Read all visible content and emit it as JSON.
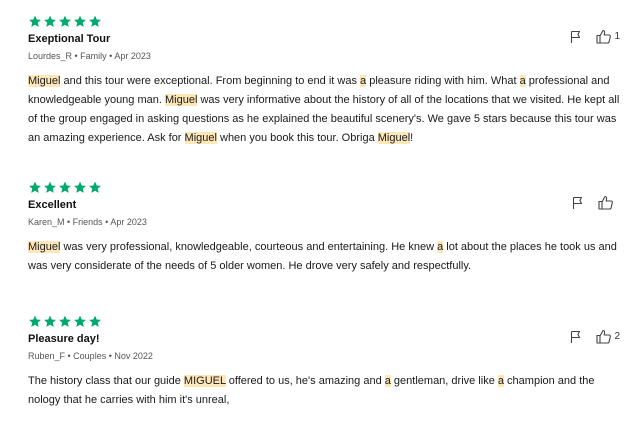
{
  "colors": {
    "star": "#00aa6c",
    "highlight": "#fde6b8"
  },
  "icons": {
    "rating": "star-icon",
    "report": "flag-icon",
    "helpful": "thumbs-up-icon"
  },
  "reviews": [
    {
      "rating": 5,
      "title": "Exeptional Tour",
      "meta": "Lourdes_R • Family • Apr 2023",
      "helpful_count": "1",
      "body": [
        {
          "t": "Miguel",
          "h": true
        },
        {
          "t": " and this tour were exceptional. From beginning to end it was "
        },
        {
          "t": "a",
          "h": true
        },
        {
          "t": " pleasure riding with him. What "
        },
        {
          "t": "a",
          "h": true
        },
        {
          "t": " professional and knowledgeable young man. "
        },
        {
          "t": "Miguel",
          "h": true
        },
        {
          "t": " was very informative about the history of all of the locations that we visited. He kept all of the group engaged in asking questions as he explained the beautiful scenery's. We gave 5 stars because this tour was an amazing experience. Ask for "
        },
        {
          "t": "Miguel",
          "h": true
        },
        {
          "t": " when you book this tour. Obriga "
        },
        {
          "t": "Miguel",
          "h": true
        },
        {
          "t": "!"
        }
      ]
    },
    {
      "rating": 5,
      "title": "Excellent",
      "meta": "Karen_M • Friends • Apr 2023",
      "helpful_count": "",
      "body": [
        {
          "t": "Miguel",
          "h": true
        },
        {
          "t": " was very professional, knowledgeable, courteous and entertaining. He knew "
        },
        {
          "t": "a",
          "h": true
        },
        {
          "t": " lot about the places he took us and was very considerate of the needs of 5 older women. He drove very safely and respectfully."
        }
      ]
    },
    {
      "rating": 5,
      "title": "Pleasure day!",
      "meta": "Ruben_F • Couples • Nov 2022",
      "helpful_count": "2",
      "body": [
        {
          "t": "The history class that our guide "
        },
        {
          "t": "MIGUEL",
          "h": true
        },
        {
          "t": " offered to us, he's amazing and "
        },
        {
          "t": "a",
          "h": true
        },
        {
          "t": " gentleman, drive like "
        },
        {
          "t": "a",
          "h": true
        },
        {
          "t": " champion and the nology that he carries with him it's unreal,"
        }
      ]
    }
  ]
}
